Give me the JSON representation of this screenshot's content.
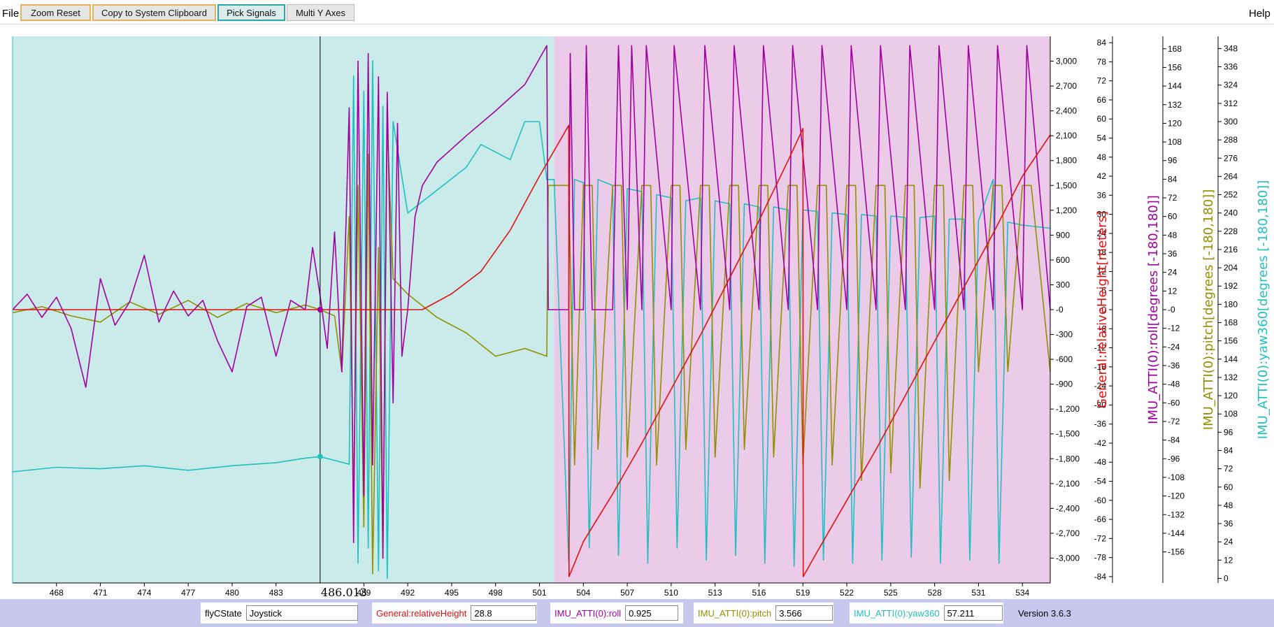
{
  "menu": {
    "file": "File",
    "help": "Help"
  },
  "toolbar": {
    "zoom_reset": "Zoom Reset",
    "copy_clipboard": "Copy to System Clipboard",
    "pick_signals": "Pick Signals",
    "multi_y_axes": "Multi Y Axes"
  },
  "status": {
    "fields": [
      {
        "label": "flyCState",
        "value": "Joystick",
        "color": "#000000"
      },
      {
        "label": "General:relativeHeight",
        "value": "28.8",
        "color": "#e01010"
      },
      {
        "label": "IMU_ATTI(0):roll",
        "value": "0.925",
        "color": "#a000a0"
      },
      {
        "label": "IMU_ATTI(0):pitch",
        "value": "3.566",
        "color": "#909000"
      },
      {
        "label": "IMU_ATTI(0):yaw360",
        "value": "57.211",
        "color": "#20c0c0"
      }
    ],
    "version": "Version 3.6.3"
  },
  "chart_data": {
    "type": "line",
    "cursor": {
      "x": 486.013,
      "label": "486.013"
    },
    "x_axis": {
      "range": [
        465.0,
        535.9
      ],
      "ticks": [
        468,
        471,
        474,
        477,
        480,
        483,
        489,
        492,
        495,
        498,
        501,
        504,
        507,
        510,
        513,
        516,
        519,
        522,
        525,
        528,
        531,
        534
      ]
    },
    "background_regions": [
      {
        "x": [
          465.0,
          502.0
        ],
        "color": "#cbeaea"
      },
      {
        "x": [
          502.0,
          535.9
        ],
        "color": "#eccbe9"
      }
    ],
    "axes": [
      {
        "id": "primary",
        "range": [
          -3300,
          3300
        ],
        "ticks": [
          3000,
          2700,
          2400,
          2100,
          1800,
          1500,
          1200,
          900,
          600,
          300,
          0,
          -300,
          -600,
          -900,
          -1200,
          -1500,
          -1800,
          -2100,
          -2400,
          -2700,
          -3000
        ],
        "tick_labels": [
          "3,000",
          "2,700",
          "2,400",
          "2,100",
          "1,800",
          "1,500",
          "1,200",
          "900",
          "600",
          "300",
          "-0",
          "-300",
          "-600",
          "-900",
          "-1,200",
          "-1,500",
          "-1,800",
          "-2,100",
          "-2,400",
          "-2,700",
          "-3,000"
        ]
      },
      {
        "id": "height",
        "label": "General:relativeHeight[meters]",
        "color": "#e01010",
        "range": [
          -86,
          86
        ],
        "ticks": [
          84,
          78,
          72,
          66,
          60,
          54,
          48,
          42,
          36,
          30,
          24,
          18,
          12,
          6,
          0,
          -6,
          -12,
          -18,
          -24,
          -30,
          -36,
          -42,
          -48,
          -54,
          -60,
          -66,
          -72,
          -78,
          -84
        ],
        "tick_labels": [
          "84",
          "78",
          "72",
          "66",
          "60",
          "54",
          "48",
          "42",
          "36",
          "30",
          "24",
          "18",
          "12",
          "6",
          "-0",
          "-6",
          "-12",
          "-18",
          "-24",
          "-30",
          "-36",
          "-42",
          "-48",
          "-54",
          "-60",
          "-66",
          "-72",
          "-78",
          "-84"
        ]
      },
      {
        "id": "roll",
        "label": "IMU_ATTI(0):roll[degrees [-180,180]]",
        "color": "#a000a0",
        "range": [
          -176,
          176
        ],
        "ticks": [
          168,
          156,
          144,
          132,
          120,
          108,
          96,
          84,
          72,
          60,
          48,
          36,
          24,
          12,
          0,
          -12,
          -24,
          -36,
          -48,
          -60,
          -72,
          -84,
          -96,
          -108,
          -120,
          -132,
          -144,
          -156
        ],
        "tick_labels": [
          "168",
          "156",
          "144",
          "132",
          "120",
          "108",
          "96",
          "84",
          "72",
          "60",
          "48",
          "36",
          "24",
          "12",
          "-0",
          "-12",
          "-24",
          "-36",
          "-48",
          "-60",
          "-72",
          "-84",
          "-96",
          "-108",
          "-120",
          "-132",
          "-144",
          "-156"
        ]
      },
      {
        "id": "pitch",
        "label": "IMU_ATTI(0):pitch[degrees [-180,180]]",
        "color": "#909000",
        "range": [
          -176,
          176
        ]
      },
      {
        "id": "yaw",
        "label": "IMU_ATTI(0):yaw360[degrees [-180,180]]",
        "color": "#20c0c0",
        "range": [
          -3,
          356
        ],
        "ticks": [
          348,
          336,
          324,
          312,
          300,
          288,
          276,
          264,
          252,
          240,
          228,
          216,
          204,
          192,
          180,
          168,
          156,
          144,
          132,
          120,
          108,
          96,
          84,
          72,
          60,
          48,
          36,
          24,
          12,
          0
        ],
        "tick_labels": [
          "348",
          "336",
          "324",
          "312",
          "300",
          "288",
          "276",
          "264",
          "252",
          "240",
          "228",
          "216",
          "204",
          "192",
          "180",
          "168",
          "156",
          "144",
          "132",
          "120",
          "108",
          "96",
          "84",
          "72",
          "60",
          "48",
          "36",
          "24",
          "12",
          "0"
        ]
      }
    ],
    "series": [
      {
        "name": "General:relativeHeight",
        "axis": "height",
        "color": "#e01010",
        "x": [
          465,
          486,
          492,
          493,
          495,
          497,
          499,
          501,
          503,
          503.02,
          504,
          506,
          508,
          510,
          512,
          514,
          516,
          518,
          519,
          519.02,
          520,
          522,
          524,
          526,
          528,
          530,
          532,
          534,
          535.9
        ],
        "y": [
          0,
          0,
          0,
          0,
          5,
          12,
          25,
          42,
          58,
          -84,
          -73,
          -58,
          -42,
          -25,
          -8,
          10,
          28,
          47,
          57,
          -84,
          -76,
          -60,
          -44,
          -27,
          -10,
          7,
          24,
          42,
          55
        ]
      },
      {
        "name": "IMU_ATTI(0):roll",
        "axis": "roll",
        "color": "#a000a0",
        "x": [
          465,
          466,
          467,
          468,
          469,
          470,
          471,
          472,
          473,
          474,
          475,
          476,
          477,
          478,
          479,
          480,
          481,
          482,
          483,
          484,
          485,
          485.5,
          486,
          486.5,
          487,
          487.5,
          488,
          488.3,
          488.6,
          489,
          489.3,
          489.6,
          490,
          490.3,
          490.6,
          491,
          491.3,
          491.6,
          492,
          492.5,
          493,
          494,
          496,
          498,
          500,
          501.5,
          501.6,
          503,
          503.1,
          503.4,
          504,
          504.2,
          504.6,
          506,
          506.4,
          507,
          507.3,
          508,
          508.3,
          510,
          510.2,
          512,
          512.3,
          514,
          514.3,
          516,
          516.3,
          518,
          518.3,
          520,
          520.3,
          522,
          522.3,
          524,
          524.3,
          526,
          526.3,
          528,
          528.3,
          530,
          530.3,
          532,
          532.3,
          534,
          534.3,
          535.9
        ],
        "y": [
          0,
          10,
          -5,
          8,
          -12,
          -50,
          20,
          -10,
          5,
          35,
          -8,
          12,
          -4,
          6,
          -20,
          -40,
          2,
          8,
          -30,
          6,
          0,
          40,
          10,
          -25,
          50,
          -40,
          130,
          -150,
          160,
          -120,
          165,
          -100,
          150,
          -160,
          140,
          -60,
          120,
          -30,
          0,
          60,
          80,
          95,
          112,
          128,
          145,
          170,
          0,
          0,
          165,
          0,
          0,
          170,
          0,
          0,
          170,
          0,
          170,
          0,
          170,
          0,
          170,
          0,
          170,
          0,
          170,
          0,
          170,
          0,
          170,
          0,
          170,
          0,
          170,
          0,
          170,
          0,
          170,
          0,
          170,
          0,
          170,
          0,
          170,
          0,
          170,
          0
        ]
      },
      {
        "name": "IMU_ATTI(0):pitch",
        "axis": "pitch",
        "color": "#909000",
        "x": [
          465,
          467,
          469,
          471,
          473,
          475,
          477,
          479,
          481,
          483,
          485,
          486,
          487,
          487.5,
          488,
          488.3,
          488.6,
          489,
          489.3,
          489.6,
          490,
          490.3,
          490.6,
          491,
          492,
          494,
          496,
          498,
          500,
          501.5,
          501.6,
          502,
          503,
          503.4,
          504,
          504.6,
          505,
          506,
          506.6,
          507,
          508,
          508.6,
          509,
          510,
          510.6,
          511,
          512,
          512.6,
          513,
          514,
          514.6,
          515,
          516,
          516.6,
          517,
          518,
          518.6,
          519,
          520,
          520.6,
          521,
          522,
          522.6,
          523,
          524,
          524.6,
          525,
          526,
          526.6,
          527,
          528,
          528.6,
          529,
          530,
          530.6,
          531,
          532,
          532.6,
          533,
          534,
          534.6,
          535.9
        ],
        "y": [
          -2,
          2,
          -4,
          -8,
          5,
          -3,
          6,
          -5,
          4,
          -2,
          3,
          0,
          -4,
          -40,
          60,
          -120,
          80,
          -140,
          100,
          -170,
          40,
          -160,
          120,
          20,
          10,
          -5,
          -15,
          -30,
          -25,
          -30,
          80,
          80,
          80,
          -100,
          80,
          80,
          -90,
          80,
          80,
          -95,
          80,
          80,
          -100,
          80,
          80,
          -90,
          80,
          80,
          -95,
          80,
          80,
          -90,
          80,
          80,
          -95,
          80,
          80,
          -100,
          80,
          80,
          -100,
          80,
          80,
          -110,
          80,
          80,
          -105,
          80,
          80,
          -115,
          80,
          80,
          -110,
          80,
          80,
          -40,
          80,
          80,
          -40,
          80,
          80,
          -40
        ]
      },
      {
        "name": "IMU_ATTI(0):yaw360",
        "axis": "yaw",
        "color": "#20c0c0",
        "x": [
          465,
          468,
          471,
          474,
          477,
          480,
          483,
          485,
          486,
          488,
          488.3,
          488.6,
          489,
          489.3,
          489.6,
          490,
          490.3,
          490.6,
          491,
          492,
          494,
          496,
          497,
          499,
          500,
          501,
          501.5,
          502,
          503,
          503.4,
          504,
          504.4,
          505,
          506,
          506.4,
          507,
          508,
          508.4,
          509,
          510,
          510.4,
          511,
          512,
          512.4,
          513,
          514,
          514.4,
          515,
          516,
          516.4,
          517,
          518,
          518.4,
          519,
          520,
          520.4,
          521,
          522,
          522.4,
          523,
          524,
          524.4,
          525,
          526,
          526.4,
          527,
          528,
          528.4,
          529,
          530,
          530.4,
          531,
          532,
          532.4,
          533,
          534,
          535.9
        ],
        "y": [
          70,
          73,
          72,
          74,
          71,
          74,
          76,
          79,
          80,
          75,
          330,
          10,
          320,
          20,
          340,
          5,
          310,
          0,
          300,
          240,
          255,
          270,
          285,
          275,
          300,
          300,
          262,
          262,
          10,
          262,
          260,
          20,
          262,
          258,
          15,
          256,
          254,
          10,
          252,
          250,
          20,
          248,
          250,
          12,
          248,
          246,
          15,
          246,
          244,
          10,
          244,
          242,
          8,
          242,
          241,
          12,
          240,
          239,
          10,
          239,
          238,
          12,
          238,
          237,
          14,
          237,
          238,
          10,
          236,
          236,
          12,
          235,
          262,
          10,
          234,
          232,
          230
        ]
      }
    ],
    "cursor_markers": [
      {
        "series": "General:relativeHeight",
        "y": 0
      },
      {
        "series": "IMU_ATTI(0):roll",
        "y": 0
      },
      {
        "series": "IMU_ATTI(0):yaw360",
        "y": 80
      }
    ]
  }
}
